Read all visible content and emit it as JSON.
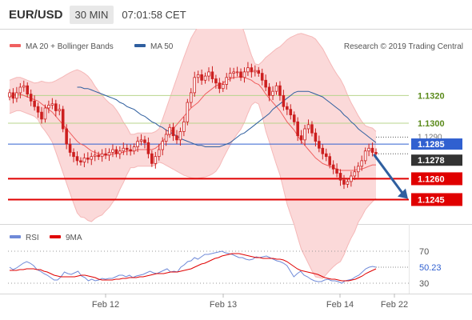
{
  "header": {
    "symbol": "EUR/USD",
    "interval": "30 MIN",
    "time": "07:01:58 CET"
  },
  "legend": {
    "ma20": "MA 20 + Bollinger Bands",
    "ma50": "MA 50",
    "rsi": "RSI",
    "ma9": "9MA",
    "credit": "Research © 2019 Trading Central"
  },
  "colors": {
    "candle": "#cc1f1f",
    "ma20": "#f06060",
    "bollinger_fill": "#fbd9d9",
    "ma50": "#2f5f9f",
    "current_price": "#3060d0",
    "support": "#e00000",
    "resistance": "#b8d48c",
    "rsi": "#6f8ad8",
    "rsi_ma": "#e00000",
    "arrow": "#2f5f9f"
  },
  "chart_data": [
    {
      "type": "candlestick",
      "ylim": [
        1.1232,
        1.1345
      ],
      "price_levels": [
        {
          "value": 1.132,
          "label": "1.1320",
          "kind": "resistance"
        },
        {
          "value": 1.13,
          "label": "1.1300",
          "kind": "resistance"
        },
        {
          "value": 1.129,
          "label": "1.1290",
          "kind": "previous-price"
        },
        {
          "value": 1.1285,
          "label": "1.1285",
          "kind": "current-price"
        },
        {
          "value": 1.1278,
          "label": "1.1278",
          "kind": "last-close"
        },
        {
          "value": 1.126,
          "label": "1.1260",
          "kind": "support"
        },
        {
          "value": 1.1245,
          "label": "1.1245",
          "kind": "support"
        }
      ],
      "x_ticks": [
        "Feb 12",
        "Feb 13",
        "Feb 14",
        "Feb 22"
      ],
      "closes": [
        1.1322,
        1.1318,
        1.1322,
        1.1326,
        1.1327,
        1.1321,
        1.1316,
        1.1312,
        1.1308,
        1.1303,
        1.1311,
        1.1313,
        1.1314,
        1.1309,
        1.131,
        1.1296,
        1.1285,
        1.1279,
        1.1276,
        1.1273,
        1.1272,
        1.1275,
        1.1274,
        1.1276,
        1.1277,
        1.1276,
        1.1278,
        1.1277,
        1.1279,
        1.1281,
        1.1278,
        1.128,
        1.1282,
        1.1281,
        1.128,
        1.1283,
        1.1287,
        1.1288,
        1.1286,
        1.1278,
        1.1271,
        1.1276,
        1.1281,
        1.1287,
        1.1292,
        1.1297,
        1.1291,
        1.1288,
        1.1294,
        1.1301,
        1.1315,
        1.1322,
        1.1333,
        1.1335,
        1.1331,
        1.1334,
        1.1337,
        1.1332,
        1.1329,
        1.1325,
        1.1328,
        1.1333,
        1.1336,
        1.1337,
        1.1337,
        1.1333,
        1.1337,
        1.134,
        1.1337,
        1.1338,
        1.1336,
        1.1331,
        1.1326,
        1.132,
        1.1323,
        1.1327,
        1.132,
        1.1312,
        1.131,
        1.1306,
        1.1301,
        1.1291,
        1.1288,
        1.1296,
        1.1299,
        1.1293,
        1.1287,
        1.1282,
        1.1278,
        1.1276,
        1.127,
        1.1267,
        1.1264,
        1.1259,
        1.1256,
        1.1258,
        1.1262,
        1.1265,
        1.1269,
        1.1273,
        1.128,
        1.1282,
        1.1279,
        1.1278
      ],
      "ma20": [
        1.1319,
        1.132,
        1.1321,
        1.1321,
        1.132,
        1.1319,
        1.1318,
        1.1317,
        1.1316,
        1.1314,
        1.1312,
        1.131,
        1.1308,
        1.1305,
        1.1302,
        1.1299,
        1.1296,
        1.1293,
        1.129,
        1.1287,
        1.1285,
        1.1284,
        1.1282,
        1.128,
        1.1279,
        1.1278,
        1.1277,
        1.1277,
        1.1277,
        1.1278,
        1.1278,
        1.1279,
        1.1279,
        1.128,
        1.128,
        1.128,
        1.1281,
        1.1281,
        1.1281,
        1.1281,
        1.1281,
        1.1282,
        1.1284,
        1.1287,
        1.129,
        1.1293,
        1.1296,
        1.1299,
        1.1302,
        1.1305,
        1.1308,
        1.1311,
        1.1313,
        1.1315,
        1.1318,
        1.1321,
        1.1323,
        1.1325,
        1.1327,
        1.1328,
        1.1329,
        1.1331,
        1.1332,
        1.1333,
        1.1333,
        1.1334,
        1.1333,
        1.1332,
        1.1331,
        1.1329,
        1.1328,
        1.1325,
        1.1321,
        1.1318,
        1.1315,
        1.1312,
        1.1309,
        1.1305,
        1.1301,
        1.1298,
        1.1295,
        1.1291,
        1.1287,
        1.1284,
        1.1281,
        1.1278,
        1.1275,
        1.1273,
        1.1271,
        1.127,
        1.1269,
        1.1268,
        1.1267,
        1.1266,
        1.1266,
        1.1266,
        1.1266,
        1.1266,
        1.1267,
        1.1267,
        1.1268,
        1.1269,
        1.127,
        1.127
      ],
      "ma50": [
        1.1326,
        1.1326,
        1.1325,
        1.1325,
        1.1324,
        1.1323,
        1.1322,
        1.1321,
        1.132,
        1.1319,
        1.1318,
        1.1317,
        1.1315,
        1.1314,
        1.1312,
        1.1311,
        1.131,
        1.1308,
        1.1306,
        1.1305,
        1.1303,
        1.1301,
        1.13,
        1.1298,
        1.1297,
        1.1295,
        1.1294,
        1.1292,
        1.1291,
        1.1289,
        1.1288,
        1.1287,
        1.1286,
        1.1285,
        1.1284,
        1.1284,
        1.1283,
        1.1283,
        1.1283,
        1.1283,
        1.1283,
        1.1284,
        1.1285,
        1.1286,
        1.1288,
        1.129,
        1.1292,
        1.1293,
        1.1295,
        1.1297,
        1.1299,
        1.1301,
        1.1303,
        1.1305,
        1.1307,
        1.131,
        1.1312,
        1.1314,
        1.1316,
        1.1318,
        1.132,
        1.1322,
        1.1323,
        1.1323,
        1.1323,
        1.1323,
        1.1322,
        1.1321,
        1.132,
        1.1319,
        1.1317,
        1.1315,
        1.1313,
        1.1311,
        1.1309,
        1.1306,
        1.1304,
        1.1301,
        1.1299,
        1.1296,
        1.1294,
        1.1292,
        1.129,
        1.1288,
        1.1286
      ]
    },
    {
      "type": "line",
      "title": "RSI",
      "ylim": [
        22,
        78
      ],
      "y_ticks": [
        70,
        30
      ],
      "current_value_label": "50.23",
      "rsi": [
        50,
        47,
        49,
        52,
        55,
        57,
        55,
        52,
        47,
        45,
        42,
        40,
        37,
        34,
        34,
        38,
        44,
        42,
        41,
        43,
        45,
        39,
        37,
        33,
        35,
        33,
        34,
        36,
        35,
        36,
        36,
        38,
        40,
        40,
        38,
        40,
        37,
        39,
        40,
        41,
        43,
        45,
        43,
        42,
        44,
        46,
        48,
        44,
        45,
        44,
        50,
        53,
        57,
        58,
        62,
        60,
        63,
        66,
        66,
        67,
        68,
        69,
        70,
        68,
        67,
        66,
        64,
        62,
        62,
        60,
        59,
        60,
        63,
        62,
        63,
        64,
        62,
        60,
        58,
        57,
        55,
        52,
        45,
        38,
        42,
        45,
        40,
        38,
        35,
        33,
        32,
        32,
        34,
        35,
        33,
        33,
        32,
        30,
        33,
        34,
        35,
        38,
        40,
        44,
        48,
        50,
        51,
        50
      ],
      "rsi_ma": [
        46,
        46,
        46,
        47,
        47,
        48,
        48,
        48,
        47,
        47,
        45,
        44,
        42,
        40,
        39,
        38,
        38,
        38,
        38,
        38,
        39,
        40,
        40,
        39,
        38,
        37,
        35,
        34,
        34,
        34,
        34,
        35,
        35,
        36,
        36,
        37,
        37,
        37,
        38,
        38,
        39,
        40,
        41,
        42,
        42,
        42,
        43,
        44,
        44,
        44,
        45,
        46,
        47,
        48,
        50,
        52,
        54,
        55,
        57,
        59,
        61,
        62,
        64,
        65,
        66,
        67,
        67,
        67,
        66,
        65,
        64,
        63,
        62,
        62,
        61,
        61,
        61,
        61,
        60,
        60,
        59,
        57,
        54,
        51,
        48,
        46,
        45,
        44,
        43,
        42,
        41,
        39,
        37,
        36,
        35,
        35,
        34,
        33,
        33,
        33,
        34,
        35,
        37,
        39,
        42,
        44,
        46,
        48
      ]
    }
  ]
}
